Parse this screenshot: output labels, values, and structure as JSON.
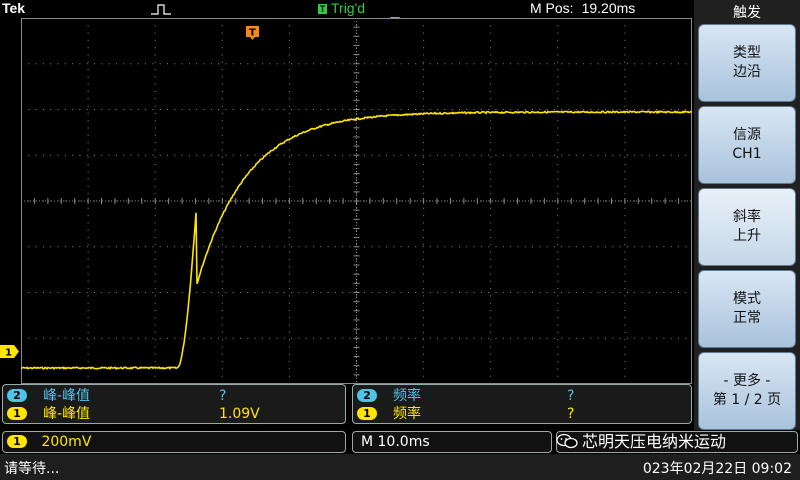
{
  "top": {
    "brand": "Tek",
    "trigger_status": "Trig'd",
    "mpos_label": "M Pos:",
    "mpos_value": "19.20ms"
  },
  "markers": {
    "channel_level": "1",
    "trigger_point": "T"
  },
  "trace": {
    "color": "#ffe600",
    "grid_color": "#8a8a8a",
    "h_divs": 10,
    "v_divs": 8
  },
  "side_menu": {
    "title": "触发",
    "buttons": [
      {
        "line1": "类型",
        "line2": "边沿"
      },
      {
        "line1": "信源",
        "line2": "CH1"
      },
      {
        "line1": "斜率",
        "line2": "上升"
      },
      {
        "line1": "模式",
        "line2": "正常"
      },
      {
        "line1": "- 更多 -",
        "line2": "第 1 / 2 页"
      }
    ]
  },
  "measurements": {
    "left": [
      {
        "channel": "2",
        "name": "峰-峰值",
        "value": "?"
      },
      {
        "channel": "1",
        "name": "峰-峰值",
        "value": "1.09V"
      }
    ],
    "right": [
      {
        "channel": "2",
        "name": "频率",
        "value": "?"
      },
      {
        "channel": "1",
        "name": "频率",
        "value": "?"
      }
    ]
  },
  "bottom": {
    "ch1_badge": "1",
    "ch1_scale": "200mV",
    "timebase": "M 10.0ms"
  },
  "status": {
    "message": "请等待...",
    "datetime": "023年02月22日 09:02"
  },
  "watermark": "芯明天压电纳米运动"
}
